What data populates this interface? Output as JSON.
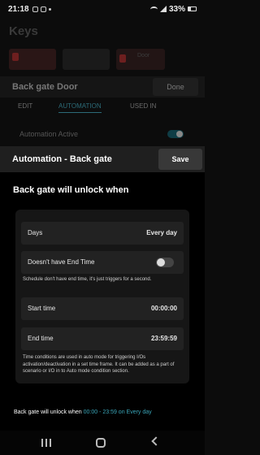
{
  "status_bar": {
    "time": "21:18",
    "battery": "33%"
  },
  "background": {
    "title": "Keys",
    "card_label": "Door",
    "door_name": "Back gate Door",
    "done_label": "Done",
    "tabs": [
      "EDIT",
      "AUTOMATION",
      "USED IN"
    ],
    "automation_active_label": "Automation Active"
  },
  "sheet": {
    "title": "Automation - Back gate",
    "save_label": "Save",
    "heading": "Back gate will unlock when",
    "days": {
      "label": "Days",
      "value": "Every day"
    },
    "end_time_toggle": {
      "label": "Doesn't have End Time",
      "on": false
    },
    "schedule_note": "Schedule don't have end time, it's just triggers for a second.",
    "start_time": {
      "label": "Start time",
      "value": "00:00:00"
    },
    "end_time": {
      "label": "End time",
      "value": "23:59:59"
    },
    "conditions_note": "Time conditions are used in auto mode for triggering I/Os activation/deactivation in a set time frame. It can be added as a part of scenario or I/O in to Auto mode condition section.",
    "summary": {
      "prefix": "Back gate will unlock when",
      "highlight": "00:00 - 23:59 on Every day"
    }
  },
  "colors": {
    "accent": "#3aa6b9",
    "background": "#000000",
    "header": "#1f1f1f",
    "row": "#222222"
  }
}
